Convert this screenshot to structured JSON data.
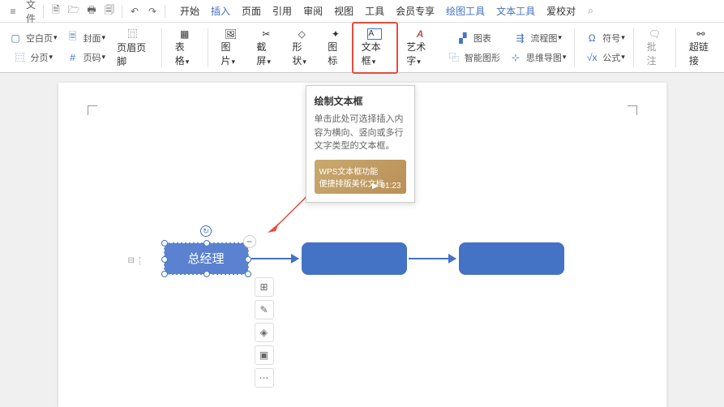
{
  "menubar": {
    "file": "文件",
    "tabs": [
      "开始",
      "插入",
      "页面",
      "引用",
      "审阅",
      "视图",
      "工具",
      "会员专享"
    ],
    "extra": [
      "绘图工具",
      "文本工具",
      "爱校对"
    ],
    "active_index": 1
  },
  "ribbon": {
    "blank_page": "空白页",
    "split_page": "分页",
    "cover": "封面",
    "page_num": "页码",
    "header_footer": "页眉页脚",
    "table": "表格",
    "image": "图片",
    "screenshot": "截屏",
    "shape": "形状",
    "icon": "图标",
    "textbox": "文本框",
    "wordart": "艺术字",
    "chart": "图表",
    "smartart": "智能图形",
    "flowchart": "流程图",
    "mindmap": "思维导图",
    "symbol": "符号",
    "formula": "公式",
    "comment": "批注",
    "hyperlink": "超链接"
  },
  "tooltip": {
    "title": "绘制文本框",
    "desc": "单击此处可选择插入内容为横向、竖向或多行文字类型的文本框。",
    "vid_line1": "WPS文本框功能",
    "vid_line2": "便捷排版美化文档",
    "duration": "01:23"
  },
  "canvas": {
    "shape1_text": "总经理"
  }
}
